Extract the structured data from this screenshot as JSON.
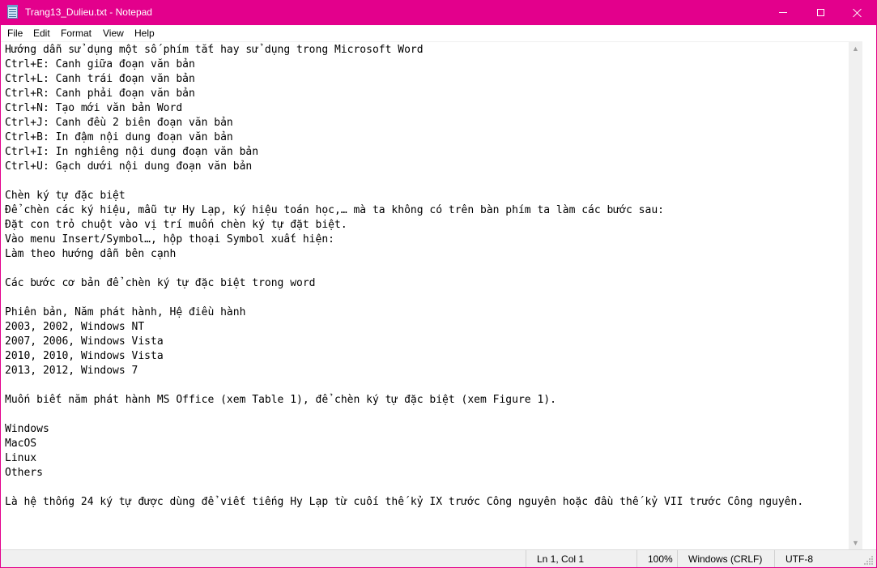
{
  "window": {
    "title": "Trang13_Dulieu.txt - Notepad",
    "accent_color": "#e3008c",
    "icon": "notepad-icon"
  },
  "controls": {
    "minimize_icon": "minimize-icon",
    "maximize_icon": "maximize-icon",
    "close_icon": "close-icon"
  },
  "menu": {
    "file": "File",
    "edit": "Edit",
    "format": "Format",
    "view": "View",
    "help": "Help"
  },
  "editor": {
    "lines": [
      "Hướng dẫn sử dụng một số phím tắt hay sử dụng trong Microsoft Word",
      "Ctrl+E: Canh giữa đoạn văn bản",
      "Ctrl+L: Canh trái đoạn văn bản",
      "Ctrl+R: Canh phải đoạn văn bản",
      "Ctrl+N: Tạo mới văn bản Word",
      "Ctrl+J: Canh đều 2 biên đoạn văn bản",
      "Ctrl+B: In đậm nội dung đoạn văn bản",
      "Ctrl+I: In nghiêng nội dung đoạn văn bản",
      "Ctrl+U: Gạch dưới nội dung đoạn văn bản",
      "",
      "Chèn ký tự đặc biệt",
      "Để chèn các ký hiệu, mẫu tự Hy Lạp, ký hiệu toán học,… mà ta không có trên bàn phím ta làm các bước sau:",
      "Đặt con trỏ chuột vào vị trí muốn chèn ký tự đặt biệt.",
      "Vào menu Insert/Symbol…, hộp thoại Symbol xuất hiện:",
      "Làm theo hướng dẫn bên cạnh",
      "",
      "Các bước cơ bản để chèn ký tự đặc biệt trong word",
      "",
      "Phiên bản, Năm phát hành, Hệ điều hành",
      "2003, 2002, Windows NT",
      "2007, 2006, Windows Vista",
      "2010, 2010, Windows Vista",
      "2013, 2012, Windows 7",
      "",
      "Muốn biết năm phát hành MS Office (xem Table 1), để chèn ký tự đặc biệt (xem Figure 1).",
      "",
      "Windows",
      "MacOS",
      "Linux",
      "Others",
      "",
      "Là hệ thống 24 ký tự được dùng để viết tiếng Hy Lạp từ cuối thế kỷ IX trước Công nguyên hoặc đầu thế kỷ VII trước Công nguyên."
    ]
  },
  "scrollbar": {
    "up_icon": "scroll-up-icon",
    "down_icon": "scroll-down-icon"
  },
  "status": {
    "position": "Ln 1, Col 1",
    "zoom": "100%",
    "line_ending": "Windows (CRLF)",
    "encoding": "UTF-8"
  }
}
